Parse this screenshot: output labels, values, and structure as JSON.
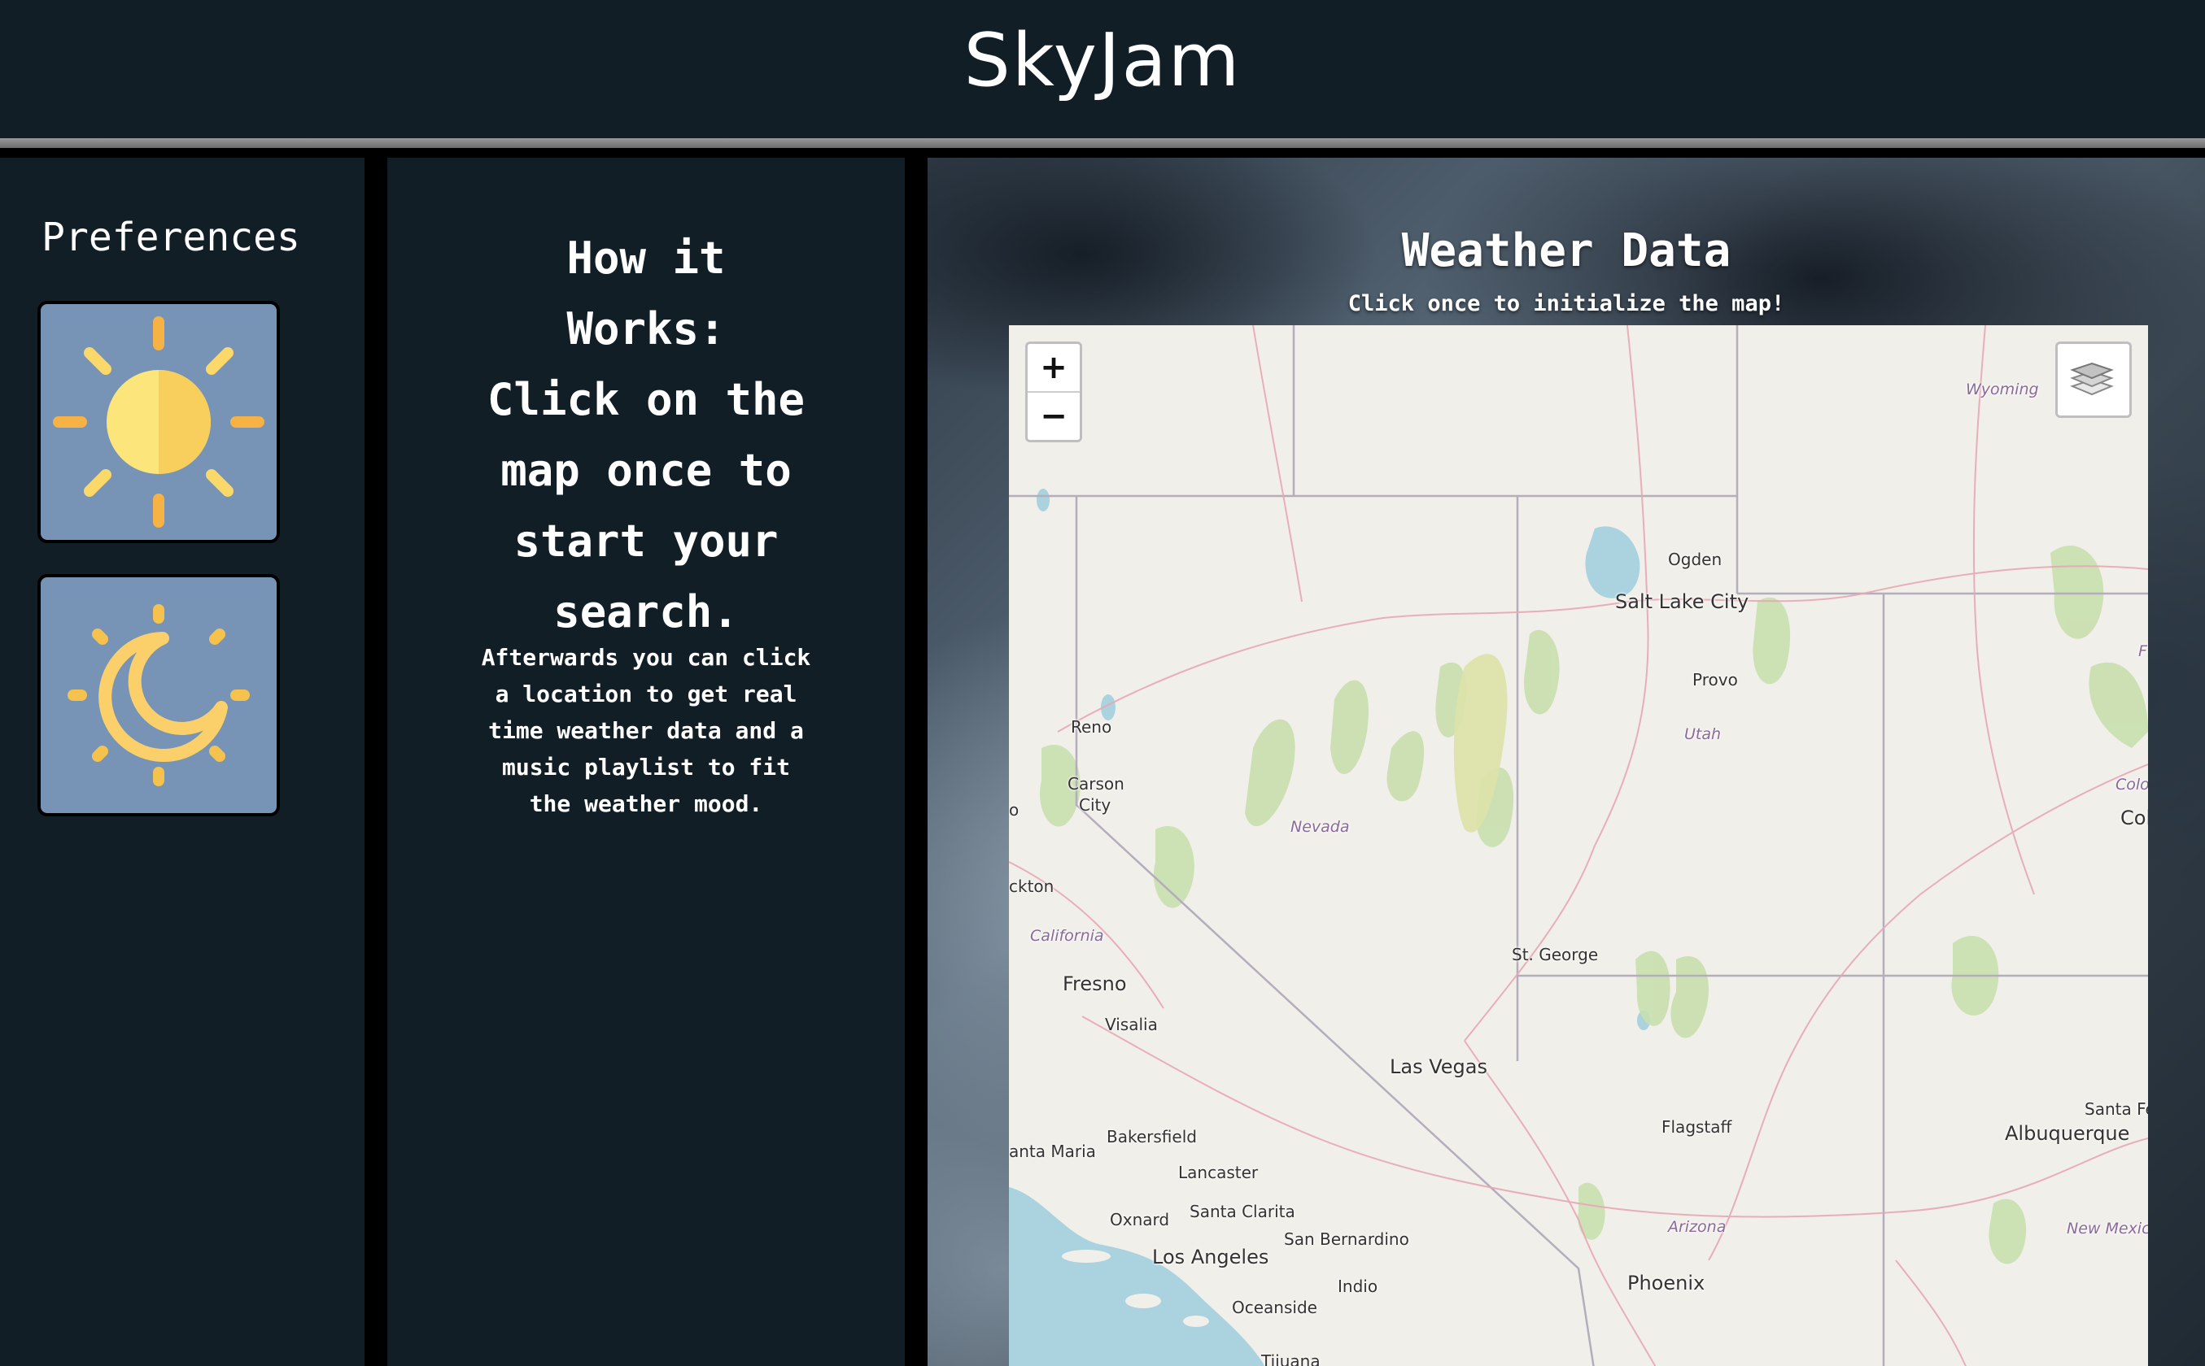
{
  "app": {
    "title": "SkyJam"
  },
  "preferences": {
    "title": "Preferences",
    "options": [
      {
        "icon": "sun-icon",
        "label": ""
      },
      {
        "icon": "moon-icon",
        "label": ""
      }
    ]
  },
  "how_it_works": {
    "heading_lines": [
      "How it",
      "Works:",
      "Click on the",
      "map once to",
      "start your",
      "search."
    ],
    "body_lines": [
      "Afterwards you can click",
      "a location to get real",
      "time weather data and a",
      "music playlist to fit",
      "the weather mood."
    ]
  },
  "weather": {
    "title": "Weather Data",
    "subtitle": "Click once to initialize the map!"
  },
  "map": {
    "zoom_in": "+",
    "zoom_out": "−",
    "layers_icon": "layers-icon",
    "cities": [
      {
        "name": "Ogden"
      },
      {
        "name": "Salt Lake City"
      },
      {
        "name": "Provo"
      },
      {
        "name": "Reno"
      },
      {
        "name": "Carson"
      },
      {
        "name": "City"
      },
      {
        "name": "ckton"
      },
      {
        "name": "Fresno"
      },
      {
        "name": "Visalia"
      },
      {
        "name": "St. George"
      },
      {
        "name": "Las Vegas"
      },
      {
        "name": "Bakersfield"
      },
      {
        "name": "anta Maria"
      },
      {
        "name": "Lancaster"
      },
      {
        "name": "Oxnard"
      },
      {
        "name": "Santa Clarita"
      },
      {
        "name": "San Bernardino"
      },
      {
        "name": "Los Angeles"
      },
      {
        "name": "Indio"
      },
      {
        "name": "Oceanside"
      },
      {
        "name": "Tijuana"
      },
      {
        "name": "Flagstaff"
      },
      {
        "name": "Phoenix"
      },
      {
        "name": "Albuquerque"
      },
      {
        "name": "Santa Fe"
      },
      {
        "name": "Col"
      },
      {
        "name": "o"
      }
    ],
    "states": [
      {
        "name": "Wyoming"
      },
      {
        "name": "Utah"
      },
      {
        "name": "Nevada"
      },
      {
        "name": "California"
      },
      {
        "name": "Arizona"
      },
      {
        "name": "New Mexico"
      },
      {
        "name": "Colo"
      },
      {
        "name": "F"
      }
    ]
  }
}
